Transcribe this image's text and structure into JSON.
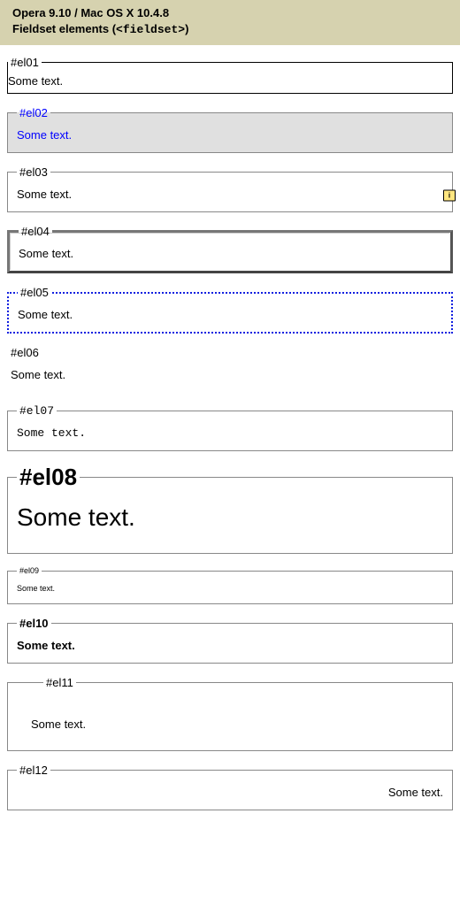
{
  "header": {
    "line1": "Opera 9.10 / Mac OS X 10.4.8",
    "line2_prefix": "Fieldset elements (",
    "line2_tag": "<fieldset>",
    "line2_suffix": ")"
  },
  "items": [
    {
      "legend": "#el01",
      "body": "Some text."
    },
    {
      "legend": "#el02",
      "body": "Some text."
    },
    {
      "legend": "#el03",
      "body": "Some text.",
      "badge": "i"
    },
    {
      "legend": "#el04",
      "body": "Some text."
    },
    {
      "legend": "#el05",
      "body": "Some text."
    },
    {
      "legend": "#el06",
      "body": "Some text."
    },
    {
      "legend": "#el07",
      "body": "Some text."
    },
    {
      "legend": "#el08",
      "body": "Some text."
    },
    {
      "legend": "#el09",
      "body": "Some text."
    },
    {
      "legend": "#el10",
      "body": "Some text."
    },
    {
      "legend": "#el11",
      "body": "Some text."
    },
    {
      "legend": "#el12",
      "body": "Some text."
    }
  ]
}
